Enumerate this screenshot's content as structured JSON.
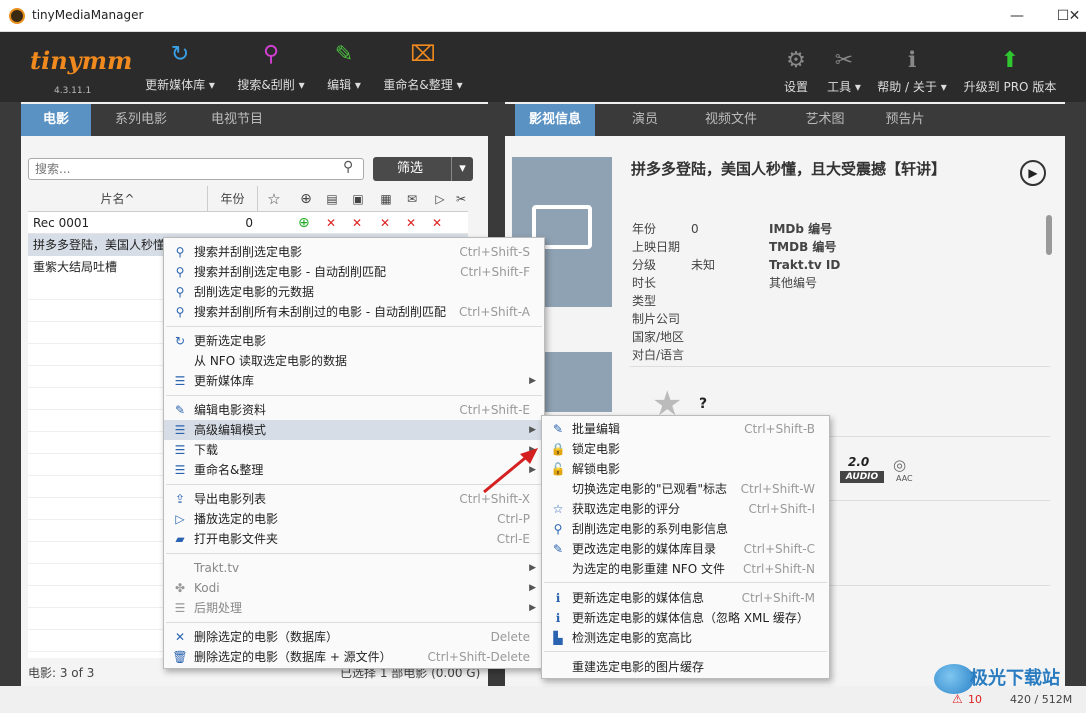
{
  "window": {
    "title": "tinyMediaManager",
    "minimize": "—",
    "maximize": "☐",
    "close": "✕"
  },
  "brand": {
    "logo": "tinymm",
    "version": "4.3.11.1"
  },
  "toolbar": {
    "left": [
      {
        "icon": "refresh-icon",
        "glyph": "↻",
        "label": "更新媒体库 ▾",
        "color": "#3aa0e8"
      },
      {
        "icon": "search-icon",
        "glyph": "⚲",
        "label": "搜索&刮削 ▾",
        "color": "#d040d0"
      },
      {
        "icon": "edit-icon",
        "glyph": "✎",
        "label": "编辑 ▾",
        "color": "#4cc040"
      },
      {
        "icon": "rename-icon",
        "glyph": "⌧",
        "label": "重命名&整理 ▾",
        "color": "#f08a1e"
      }
    ],
    "right": [
      {
        "icon": "gear-icon",
        "glyph": "⚙",
        "label": "设置"
      },
      {
        "icon": "tools-icon",
        "glyph": "✂",
        "label": "工具 ▾"
      },
      {
        "icon": "info-icon",
        "glyph": "ℹ",
        "label": "帮助 / 关于 ▾"
      },
      {
        "icon": "upgrade-icon",
        "glyph": "⬆",
        "label": "升级到 PRO 版本"
      }
    ]
  },
  "left_tabs": [
    "电影",
    "系列电影",
    "电视节目"
  ],
  "right_tabs": [
    "影视信息",
    "演员",
    "视频文件",
    "艺术图",
    "预告片"
  ],
  "search": {
    "placeholder": "搜索..."
  },
  "filter": {
    "label": "筛选",
    "arrow": "▾"
  },
  "table": {
    "col_title": "片名^",
    "col_year": "年份",
    "rows": [
      {
        "title": "Rec 0001",
        "year": "0"
      },
      {
        "title": "拼多多登陆，美国人秒懂",
        "year": "0"
      },
      {
        "title": "重紫大结局吐槽",
        "year": ""
      }
    ]
  },
  "status": {
    "count": "电影:  3  of  3",
    "selected": "已选择 1 部电影 (0.00 G)",
    "errors": "10",
    "memory": "420 / 512M"
  },
  "detail": {
    "title": "拼多多登陆，美国人秒懂，且大受震撼【轩讲】",
    "labels": [
      "年份",
      "上映日期",
      "分级",
      "时长",
      "类型",
      "制片公司",
      "国家/地区",
      "对白/语言"
    ],
    "values": [
      "0",
      "",
      "未知",
      "",
      "",
      "",
      "",
      ""
    ],
    "ids": [
      "IMDb 编号",
      "TMDB 编号",
      "Trakt.tv ID",
      "其他编号"
    ],
    "rating": "?",
    "audio": "2.0",
    "audio_label": "AUDIO",
    "codec": "AAC"
  },
  "context_menu": [
    {
      "icon": "⚲",
      "label": "搜索并刮削选定电影",
      "key": "Ctrl+Shift-S"
    },
    {
      "icon": "⚲",
      "label": "搜索并刮削选定电影 - 自动刮削匹配",
      "key": "Ctrl+Shift-F"
    },
    {
      "icon": "⚲",
      "label": "刮削选定电影的元数据",
      "key": ""
    },
    {
      "icon": "⚲",
      "label": "搜索并刮削所有未刮削过的电影 - 自动刮削匹配",
      "key": "Ctrl+Shift-A"
    },
    {
      "icon": "↻",
      "label": "更新选定电影",
      "key": ""
    },
    {
      "icon": "",
      "label": "从 NFO 读取选定电影的数据",
      "key": ""
    },
    {
      "icon": "☰",
      "label": "更新媒体库",
      "key": "",
      "sub": true
    },
    {
      "icon": "✎",
      "label": "编辑电影资料",
      "key": "Ctrl+Shift-E"
    },
    {
      "icon": "☰",
      "label": "高级编辑模式",
      "key": "",
      "sub": true
    },
    {
      "icon": "☰",
      "label": "下载",
      "key": "",
      "sub": true
    },
    {
      "icon": "☰",
      "label": "重命名&整理",
      "key": "",
      "sub": true
    },
    {
      "icon": "⇪",
      "label": "导出电影列表",
      "key": "Ctrl+Shift-X"
    },
    {
      "icon": "▷",
      "label": "播放选定的电影",
      "key": "Ctrl-P"
    },
    {
      "icon": "▰",
      "label": "打开电影文件夹",
      "key": "Ctrl-E"
    },
    {
      "icon": "",
      "label": "Trakt.tv",
      "key": "",
      "sub": true
    },
    {
      "icon": "✤",
      "label": "Kodi",
      "key": "",
      "sub": true
    },
    {
      "icon": "☰",
      "label": "后期处理",
      "key": "",
      "sub": true
    },
    {
      "icon": "✕",
      "label": "删除选定的电影（数据库）",
      "key": "Delete"
    },
    {
      "icon": "🗑",
      "label": "删除选定的电影（数据库 + 源文件）",
      "key": "Ctrl+Shift-Delete"
    }
  ],
  "submenu": [
    {
      "icon": "✎",
      "label": "批量编辑",
      "key": "Ctrl+Shift-B"
    },
    {
      "icon": "🔒",
      "label": "锁定电影",
      "key": ""
    },
    {
      "icon": "🔓",
      "label": "解锁电影",
      "key": ""
    },
    {
      "icon": "",
      "label": "切换选定电影的\"已观看\"标志",
      "key": "Ctrl+Shift-W"
    },
    {
      "icon": "☆",
      "label": "获取选定电影的评分",
      "key": "Ctrl+Shift-I"
    },
    {
      "icon": "⚲",
      "label": "刮削选定电影的系列电影信息",
      "key": ""
    },
    {
      "icon": "✎",
      "label": "更改选定电影的媒体库目录",
      "key": "Ctrl+Shift-C"
    },
    {
      "icon": "",
      "label": "为选定的电影重建 NFO 文件",
      "key": "Ctrl+Shift-N"
    },
    {
      "icon": "ℹ",
      "label": "更新选定电影的媒体信息",
      "key": "Ctrl+Shift-M"
    },
    {
      "icon": "ℹ",
      "label": "更新选定电影的媒体信息（忽略 XML 缓存）",
      "key": ""
    },
    {
      "icon": "▙",
      "label": "检测选定电影的宽高比",
      "key": ""
    },
    {
      "icon": "",
      "label": "重建选定电影的图片缓存",
      "key": ""
    }
  ],
  "watermark": "极光下载站"
}
